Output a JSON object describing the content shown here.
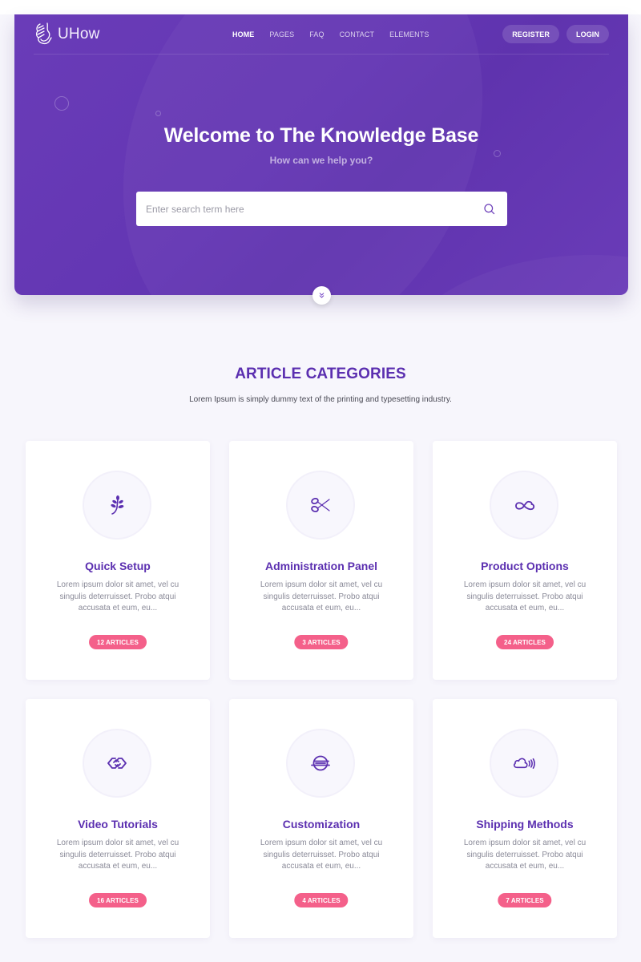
{
  "brand": {
    "name": "UHow",
    "icon": "hand-holding-logo-icon"
  },
  "nav": {
    "links": [
      {
        "label": "HOME",
        "active": true
      },
      {
        "label": "PAGES",
        "active": false
      },
      {
        "label": "FAQ",
        "active": false
      },
      {
        "label": "CONTACT",
        "active": false
      },
      {
        "label": "ELEMENTS",
        "active": false
      }
    ],
    "register_label": "REGISTER",
    "login_label": "LOGIN"
  },
  "hero": {
    "title": "Welcome to The Knowledge Base",
    "subtitle": "How can we help you?",
    "search": {
      "placeholder": "Enter search term here",
      "value": "",
      "icon": "search-icon"
    },
    "scroll_icon": "double-chevron-down-icon"
  },
  "categories": {
    "title": "ARTICLE CATEGORIES",
    "subtitle": "Lorem Ipsum is simply dummy text of the printing and typesetting industry.",
    "items": [
      {
        "title": "Quick Setup",
        "description": "Lorem ipsum dolor sit amet, vel cu singulis deterruisset. Probo atqui accusata et eum, eu...",
        "badge": "12 ARTICLES",
        "icon": "leaf-icon"
      },
      {
        "title": "Administration Panel",
        "description": "Lorem ipsum dolor sit amet, vel cu singulis deterruisset. Probo atqui accusata et eum, eu...",
        "badge": "3 ARTICLES",
        "icon": "scissors-icon"
      },
      {
        "title": "Product Options",
        "description": "Lorem ipsum dolor sit amet, vel cu singulis deterruisset. Probo atqui accusata et eum, eu...",
        "badge": "24 ARTICLES",
        "icon": "cloud-infinity-icon"
      },
      {
        "title": "Video Tutorials",
        "description": "Lorem ipsum dolor sit amet, vel cu singulis deterruisset. Probo atqui accusata et eum, eu...",
        "badge": "16 ARTICLES",
        "icon": "linked-diamonds-icon"
      },
      {
        "title": "Customization",
        "description": "Lorem ipsum dolor sit amet, vel cu singulis deterruisset. Probo atqui accusata et eum, eu...",
        "badge": "4 ARTICLES",
        "icon": "planet-lines-icon"
      },
      {
        "title": "Shipping Methods",
        "description": "Lorem ipsum dolor sit amet, vel cu singulis deterruisset. Probo atqui accusata et eum, eu...",
        "badge": "7 ARTICLES",
        "icon": "cloud-signal-icon"
      }
    ]
  },
  "colors": {
    "primary": "#6336b3",
    "heading": "#5b2fb0",
    "badge": "#f4608a",
    "background": "#f7f6fc"
  }
}
